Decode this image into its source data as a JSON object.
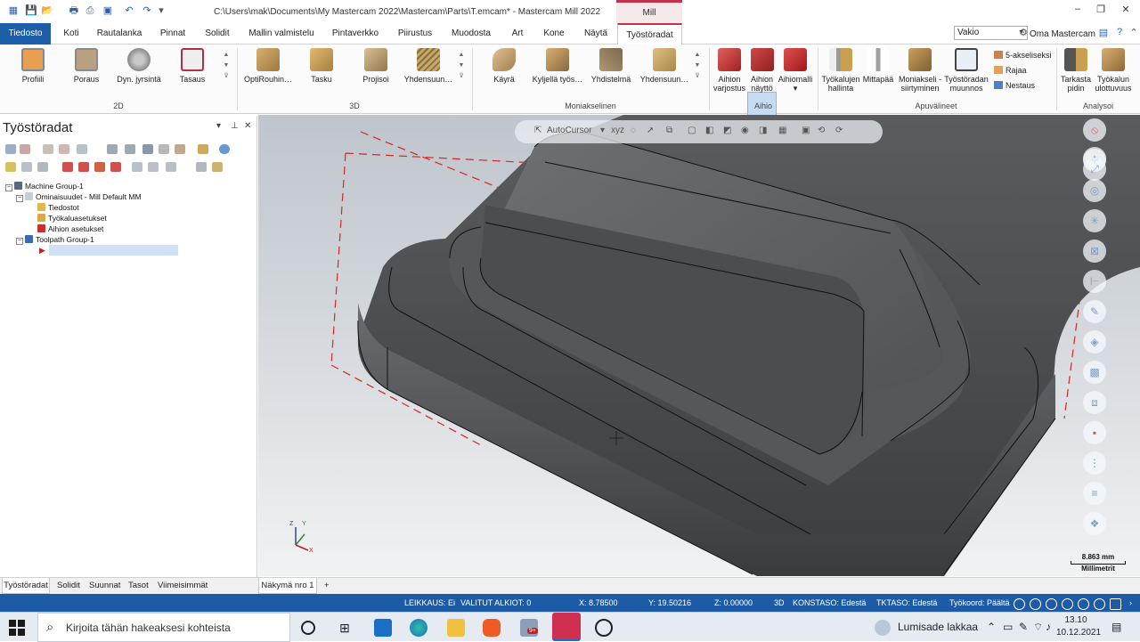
{
  "window": {
    "title": "C:\\Users\\mak\\Documents\\My Mastercam 2022\\Mastercam\\Parts\\T.emcam* - Mastercam Mill 2022",
    "context_tab": "Mill",
    "controls": {
      "minimize": "–",
      "restore": "❐",
      "close": "✕"
    }
  },
  "menu": {
    "file": "Tiedosto",
    "tabs": [
      "Koti",
      "Rautalanka",
      "Pinnat",
      "Solidit",
      "Mallin valmistelu",
      "Pintaverkko",
      "Piirustus",
      "Muodosta",
      "Art",
      "Kone",
      "Näytä"
    ],
    "active": "Työstöradat",
    "config_select": "Vakio",
    "my_mastercam": "Oma Mastercam"
  },
  "ribbon": {
    "groups": [
      "2D",
      "3D",
      "Moniakselinen",
      "Aihio",
      "Apuvälineet",
      "Analysoi"
    ],
    "buttons_2d": [
      "Profiili",
      "Poraus",
      "Dyn. jyrsintä",
      "Tasaus"
    ],
    "buttons_3d": [
      "OptiRouhin…",
      "Tasku",
      "Projisoi",
      "Yhdensuun…"
    ],
    "buttons_multi": [
      "Käyrä",
      "Kyljellä työs…",
      "Yhdistelmä",
      "Yhdensuun…"
    ],
    "buttons_stock": [
      "Aihion varjostus",
      "Aihion näyttö",
      "Aihiomalli"
    ],
    "buttons_utils": [
      "Työkalujen hallinta",
      "Mittapää",
      "Moniakseli -siirtyminen",
      "Työstöradan muunnos"
    ],
    "small_utils": [
      "5-akseliseksi",
      "Rajaa",
      "Nestaus"
    ],
    "buttons_analyze": [
      "Tarkasta pidin",
      "Työkalun ulottuvuus"
    ]
  },
  "panel": {
    "title": "Työstöradat",
    "tree": [
      "Machine Group-1",
      "Ominaisuudet - Mill Default MM",
      "Tiedostot",
      "Työkaluasetukset",
      "Aihion asetukset",
      "Toolpath Group-1"
    ]
  },
  "viewport": {
    "autocursor": "AutoCursor",
    "scale_value": "8.863 mm",
    "scale_unit": "Millimetrit",
    "axis_labels": {
      "z": "Z",
      "y": "Y",
      "x": "X"
    }
  },
  "bottom_tabs": [
    "Työstöradat",
    "Solidit",
    "Suunnat",
    "Tasot",
    "Viimeisimmät"
  ],
  "view_tab": "Näkymä nro 1",
  "view_add": "+",
  "status": {
    "leikkaus": "LEIKKAUS: Ei",
    "valitut": "VALITUT ALKIOT: 0",
    "x": "X:   8.78500",
    "y": "Y:   19.50216",
    "z": "Z:   0.00000",
    "mode": "3D",
    "konstaso": "KONSTASO: Edestä",
    "tktaso": "TKTASO: Edestä",
    "tyokoord": "Työkoord: Päältä"
  },
  "taskbar": {
    "search_placeholder": "Kirjoita tähän hakeaksesi kohteista",
    "weather": "Lumisade lakkaa",
    "time": "13.10",
    "date": "10.12.2021",
    "badge": "9+"
  }
}
